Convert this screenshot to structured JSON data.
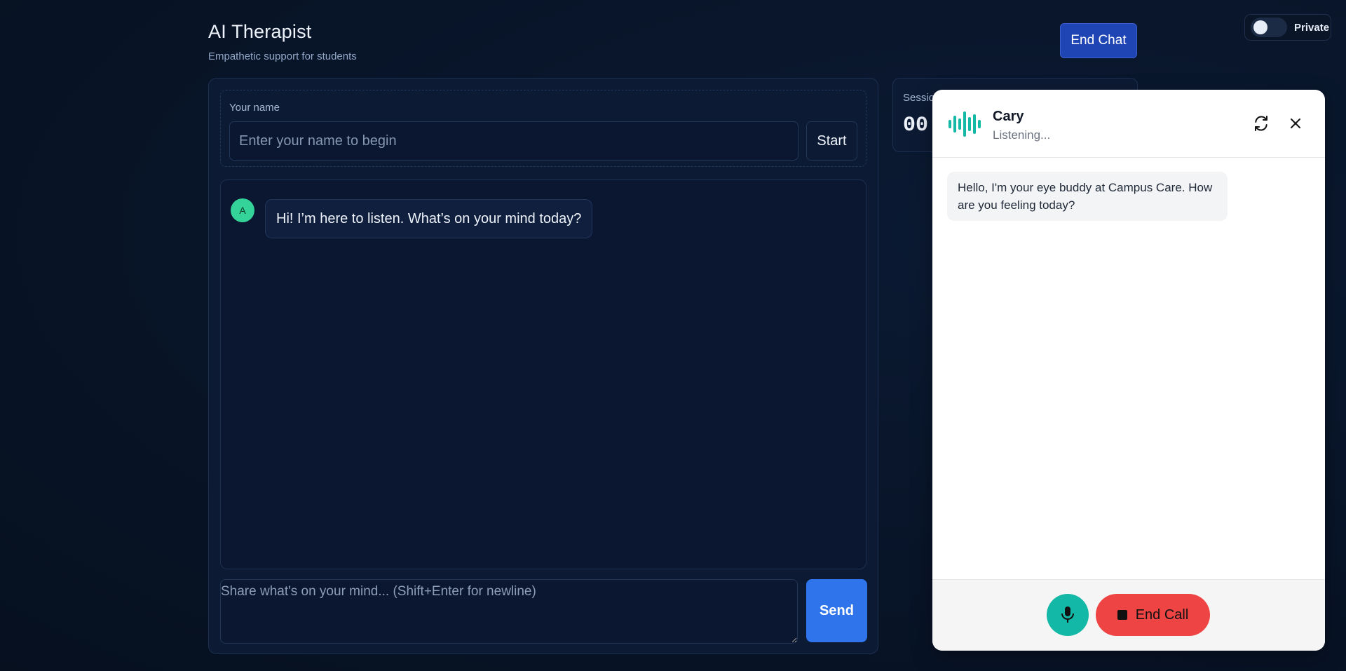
{
  "header": {
    "title": "AI Therapist",
    "subtitle": "Empathetic support for students",
    "end_chat_label": "End Chat"
  },
  "privacy": {
    "label": "Private",
    "enabled": false
  },
  "name_section": {
    "label": "Your name",
    "input_placeholder": "Enter your name to begin",
    "input_value": "",
    "start_label": "Start"
  },
  "chat": {
    "messages": [
      {
        "role": "assistant",
        "avatar": "A",
        "text": "Hi! I’m here to listen. What’s on your mind today?"
      }
    ],
    "composer_placeholder": "Share what's on your mind... (Shift+Enter for newline)",
    "send_label": "Send"
  },
  "session": {
    "label": "Session",
    "time": "00:"
  },
  "voice_widget": {
    "agent_name": "Cary",
    "status": "Listening...",
    "icons": {
      "wave": "audio-wave-icon",
      "refresh": "refresh-icon",
      "close": "close-icon",
      "mic": "microphone-icon",
      "stop": "stop-icon"
    },
    "messages": [
      {
        "role": "assistant",
        "text": "Hello, I'm your eye buddy at Campus Care. How are you feeling today?"
      }
    ],
    "end_call_label": "End Call",
    "colors": {
      "accent": "#14b8a6",
      "danger": "#ef4444"
    }
  },
  "colors": {
    "primary_button": "#1f45b5",
    "send_button": "#2f74ea",
    "avatar": "#34d399"
  }
}
